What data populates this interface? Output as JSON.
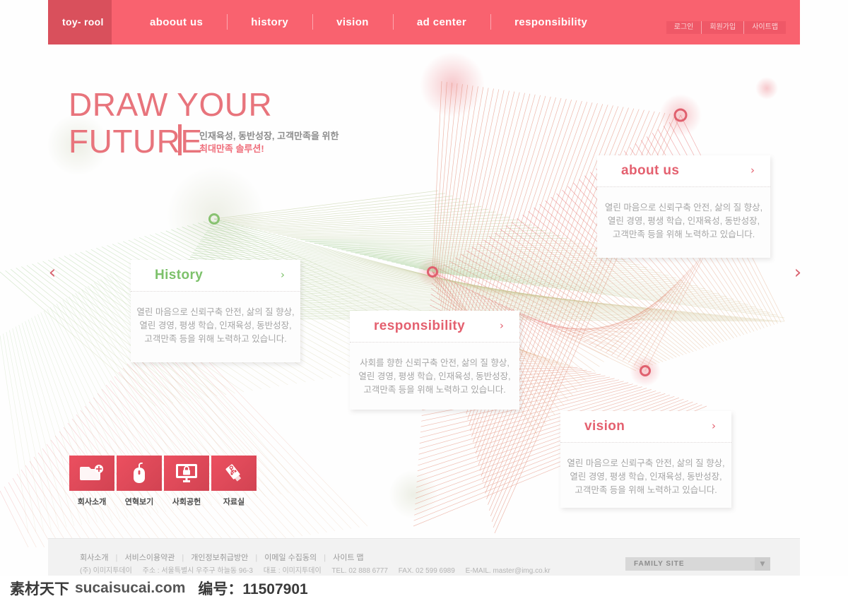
{
  "nav": {
    "logo": "toy-\nrool",
    "items": [
      {
        "label": "aboout us"
      },
      {
        "label": "history"
      },
      {
        "label": "vision"
      },
      {
        "label": "ad center"
      },
      {
        "label": "responsibility"
      }
    ],
    "utility": [
      {
        "label": "로그인"
      },
      {
        "label": "회원가입"
      },
      {
        "label": "사이트맵"
      }
    ]
  },
  "hero": {
    "headline": "DRAW YOUR\nFUTURE",
    "sub_line1": "인재육성, 동반성장, 고객만족을 위한",
    "sub_line2": "최대만족 솔루션!",
    "prev_icon": "chevron-left",
    "next_icon": "chevron-right"
  },
  "cards": [
    {
      "key": "about",
      "title": "about  us",
      "accent": "#e4606f",
      "chevron": "›",
      "lines": [
        "열린 마음으로 신뢰구축 안전, 삶의 질 향상,",
        "열린 경영, 평생 학습, 인재육성, 동반성장,",
        "고객만족 등을 위해 노력하고 있습니다."
      ]
    },
    {
      "key": "history",
      "title": "History",
      "accent": "#7cc16a",
      "chevron": "›",
      "lines": [
        "열린 마음으로 신뢰구축 안전, 삶의 질 향상,",
        "열린 경영, 평생 학습, 인재육성, 동반성장,",
        "고객만족 등을 위해 노력하고 있습니다."
      ]
    },
    {
      "key": "responsibility",
      "title": "responsibility",
      "accent": "#e4606f",
      "chevron": "›",
      "lines": [
        "사회를 향한 신뢰구축 안전, 삶의 질 향상,",
        "열린 경영, 평생 학습, 인재육성, 동반성장,",
        "고객만족 등을 위해 노력하고 있습니다."
      ]
    },
    {
      "key": "vision",
      "title": "vision",
      "accent": "#e4606f",
      "chevron": "›",
      "lines": [
        "열린 마음으로 신뢰구축 안전, 삶의 질 향상,",
        "열린 경영, 평생 학습, 인재육성, 동반성장,",
        "고객만족 등을 위해 노력하고 있습니다."
      ]
    }
  ],
  "quick_links": [
    {
      "label": "회사소개",
      "icon": "folder-add-icon"
    },
    {
      "label": "연혁보기",
      "icon": "mouse-icon"
    },
    {
      "label": "사회공헌",
      "icon": "monitor-lock-icon"
    },
    {
      "label": "자료실",
      "icon": "usb-drive-icon"
    }
  ],
  "footer": {
    "links": [
      "회사소개",
      "서비스이용약관",
      "개인정보취급방안",
      "이메일 수집동의",
      "사이트 맵"
    ],
    "separator": "|",
    "company": "(주) 이미지투데이",
    "address": "주소 : 서울특별시 우주구 하늘동 96-3",
    "ceo": "대표 : 이미지투데이",
    "tel": "TEL. 02 888 6777",
    "fax": "FAX. 02 599 6989",
    "email": "E-MAIL. master@img.co.kr",
    "family_site": "FAMILY SITE",
    "family_arrow": "▼"
  },
  "watermark": {
    "site_cn": "素材天下",
    "site_url": "sucaisucai.com",
    "code": "编号：11507901"
  },
  "colors": {
    "brand_pink": "#f9626f",
    "logo_dark": "#d9505c",
    "headline": "#e8747c",
    "green": "#7cc16a"
  }
}
